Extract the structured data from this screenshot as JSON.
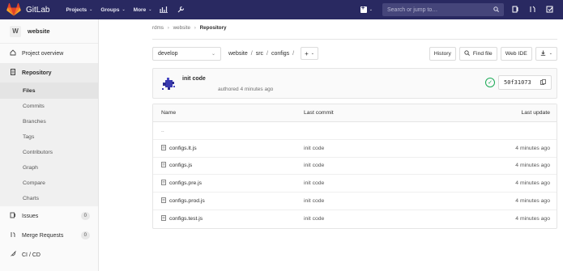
{
  "topbar": {
    "brand": "GitLab",
    "nav": [
      {
        "label": "Projects",
        "caret": "⌄"
      },
      {
        "label": "Groups",
        "caret": "⌄"
      },
      {
        "label": "More",
        "caret": "⌄"
      }
    ],
    "search_placeholder": "Search or jump to…",
    "bg_color": "#292961"
  },
  "sidebar": {
    "project_avatar": "W",
    "project_name": "website",
    "overview_label": "Project overview",
    "repository_label": "Repository",
    "repo_sub": [
      "Files",
      "Commits",
      "Branches",
      "Tags",
      "Contributors",
      "Graph",
      "Compare",
      "Charts"
    ],
    "issues_label": "Issues",
    "issues_count": "0",
    "mr_label": "Merge Requests",
    "mr_count": "0",
    "cicd_label": "CI / CD"
  },
  "breadcrumb": {
    "items": [
      "rdms",
      "website",
      "Repository"
    ],
    "sep": "›"
  },
  "toolbar": {
    "branch": "develop",
    "path": [
      "website",
      "src",
      "configs"
    ],
    "path_sep": "/",
    "add_label": "+",
    "history_label": "History",
    "find_file_label": "Find file",
    "web_ide_label": "Web IDE"
  },
  "commit": {
    "title": "init code",
    "meta": "authored 4 minutes ago",
    "sha": "50f31073",
    "status_color": "#1aaa55"
  },
  "tree": {
    "headers": {
      "name": "Name",
      "last_commit": "Last commit",
      "last_update": "Last update"
    },
    "up": "..",
    "rows": [
      {
        "name": "configs.lt.js",
        "commit": "init code",
        "updated": "4 minutes ago"
      },
      {
        "name": "configs.js",
        "commit": "init code",
        "updated": "4 minutes ago"
      },
      {
        "name": "configs.pre.js",
        "commit": "init code",
        "updated": "4 minutes ago"
      },
      {
        "name": "configs.prod.js",
        "commit": "init code",
        "updated": "4 minutes ago"
      },
      {
        "name": "configs.test.js",
        "commit": "init code",
        "updated": "4 minutes ago"
      }
    ]
  }
}
